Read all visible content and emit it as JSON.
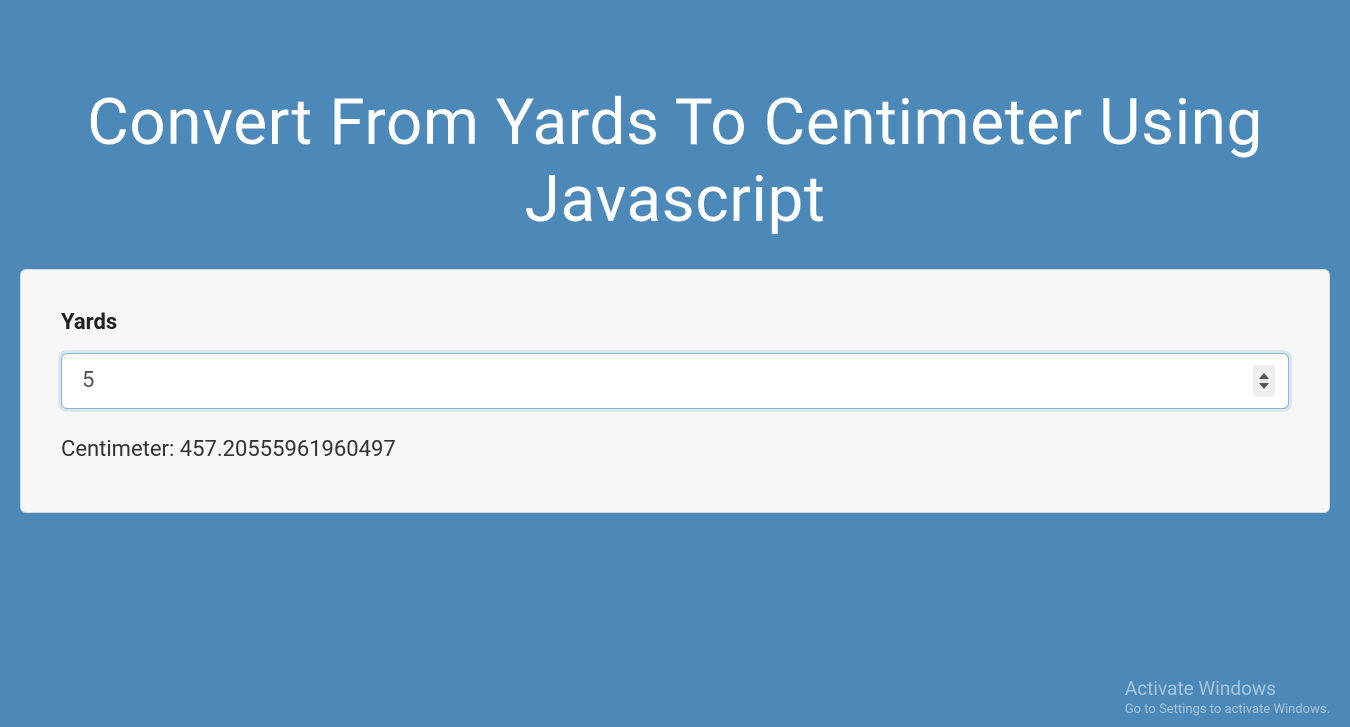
{
  "header": {
    "title": "Convert From Yards To Centimeter Using Javascript"
  },
  "form": {
    "yards_label": "Yards",
    "yards_value": "5",
    "result_text": "Centimeter: 457.20555961960497"
  },
  "watermark": {
    "title": "Activate Windows",
    "subtitle": "Go to Settings to activate Windows."
  }
}
